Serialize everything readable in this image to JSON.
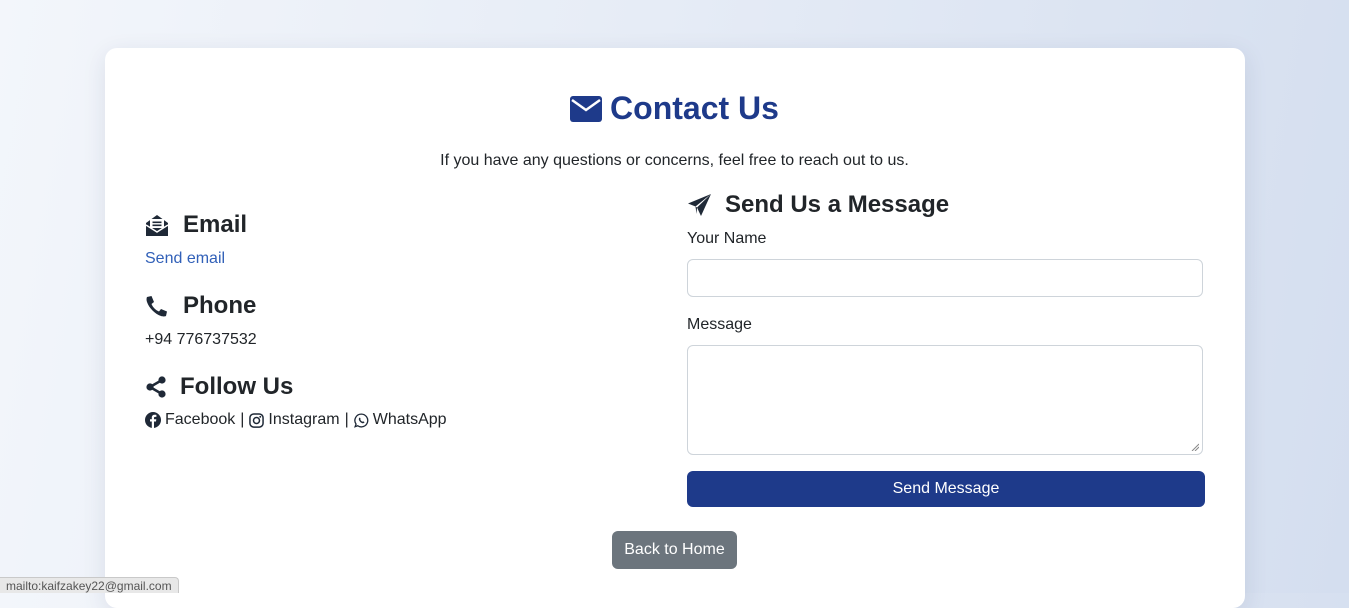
{
  "header": {
    "title": "Contact Us",
    "subtitle": "If you have any questions or concerns, feel free to reach out to us."
  },
  "contact": {
    "email_heading": "Email",
    "email_link": "Send email",
    "phone_heading": "Phone",
    "phone_value": "+94 776737532",
    "follow_heading": "Follow Us",
    "socials": [
      "Facebook",
      "Instagram",
      "WhatsApp"
    ],
    "separator": "|"
  },
  "form": {
    "heading": "Send Us a Message",
    "name_label": "Your Name",
    "name_value": "",
    "message_label": "Message",
    "message_value": "",
    "submit_label": "Send Message"
  },
  "nav": {
    "back_label": "Back to Home"
  },
  "status": {
    "link_preview": "mailto:kaifzakey22@gmail.com"
  },
  "colors": {
    "brand": "#1e3a8a",
    "link": "#3160b8",
    "secondary": "#6c757d"
  }
}
